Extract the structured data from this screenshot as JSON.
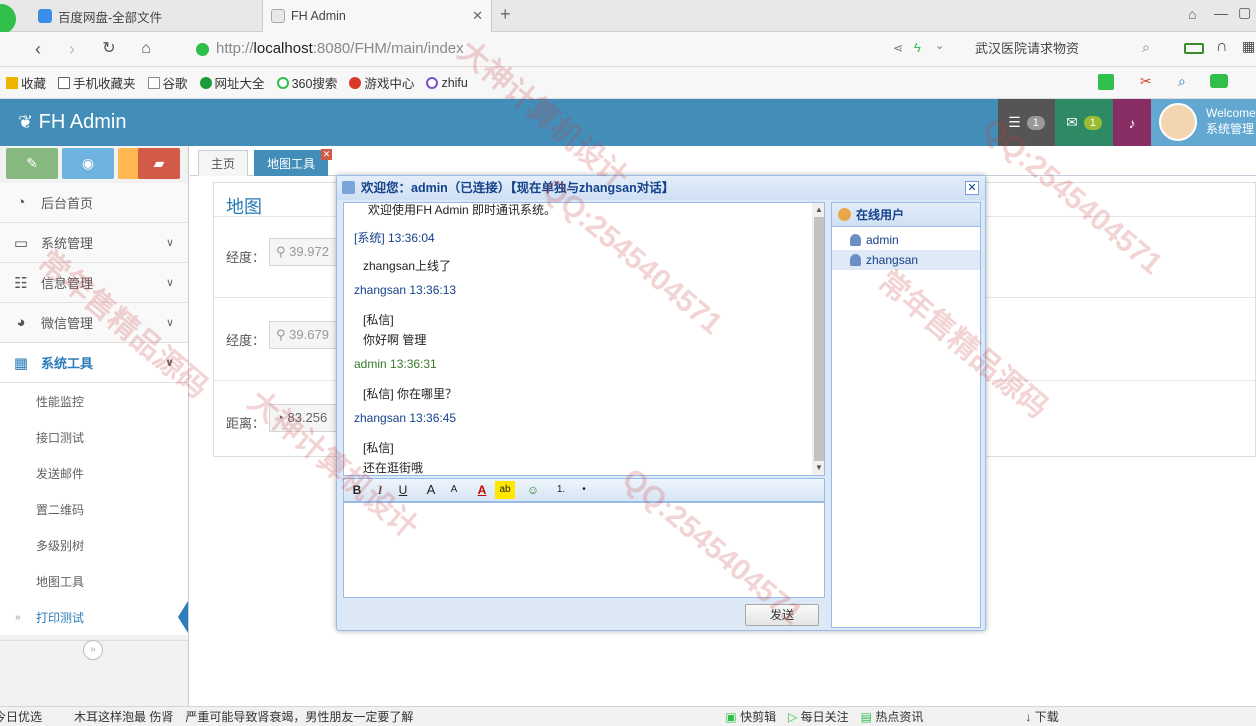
{
  "browser": {
    "tabs": [
      {
        "label": "百度网盘-全部文件"
      },
      {
        "label": "FH Admin"
      }
    ],
    "url_prefix": "http://",
    "url_host": "localhost",
    "url_rest": ":8080/FHM/main/index",
    "search_text": "武汉医院请求物资",
    "bookmarks": [
      "收藏",
      "手机收藏夹",
      "谷歌",
      "网址大全",
      "360搜索",
      "游戏中心",
      "zhifu"
    ]
  },
  "header": {
    "brand": "FH Admin",
    "tasks_count": "1",
    "messages_count": "1",
    "welcome_line1": "Welcome",
    "welcome_line2": "系统管理"
  },
  "sidebar": {
    "menu": [
      {
        "label": "后台首页",
        "icon": "dashboard-icon"
      },
      {
        "label": "系统管理",
        "icon": "desktop-icon"
      },
      {
        "label": "信息管理",
        "icon": "list-icon"
      },
      {
        "label": "微信管理",
        "icon": "comments-icon"
      },
      {
        "label": "系统工具",
        "icon": "grid-icon"
      }
    ],
    "submenu": [
      "性能监控",
      "接口测试",
      "发送邮件",
      "置二维码",
      "多级别树",
      "地图工具",
      "打印测试"
    ]
  },
  "page_tabs": {
    "home": "主页",
    "map": "地图工具"
  },
  "map_form": {
    "title": "地图",
    "lon_label": "经度：",
    "lon_value": "39.972",
    "lat_label": "经度：",
    "lat_value": "39.679",
    "distance_label": "距离：",
    "distance_value": "83.256"
  },
  "chat": {
    "title": "欢迎您：admin（已连接）【现在单独与zhangsan对话】",
    "welcome": "欢迎使用FH Admin 即时通讯系统。",
    "messages": [
      {
        "head": "[系统] 13:36:04",
        "line1": "zhangsan上线了",
        "line2": ""
      },
      {
        "head": "zhangsan 13:36:13",
        "line1": "[私信]",
        "line2": "你好啊 管理"
      },
      {
        "head": "admin 13:36:31",
        "line1": "[私信] 你在哪里？",
        "line2": ""
      },
      {
        "head": "zhangsan 13:36:45",
        "line1": "[私信]",
        "line2": "还在逛街哦"
      }
    ],
    "send_label": "发送",
    "users_title": "在线用户",
    "users": [
      "admin",
      "zhangsan"
    ],
    "toolbar": [
      "B",
      "I",
      "U",
      "A",
      "A",
      "A",
      "ab",
      "☺",
      "1.",
      "•"
    ]
  },
  "statusbar": {
    "items": [
      "今日优选",
      "木耳这样泡最 伤肾",
      "严重可能导致肾衰竭，男性朋友一定要了解",
      "快剪辑",
      "每日关注",
      "热点资讯",
      "下载"
    ]
  },
  "watermark": [
    "大神计算机设计",
    "QQ:2545404571",
    "常年售精品源码"
  ],
  "colors": {
    "header_bg": "#438eb9",
    "chat_border": "#99bbe8",
    "accent": "#2b7dbc"
  }
}
